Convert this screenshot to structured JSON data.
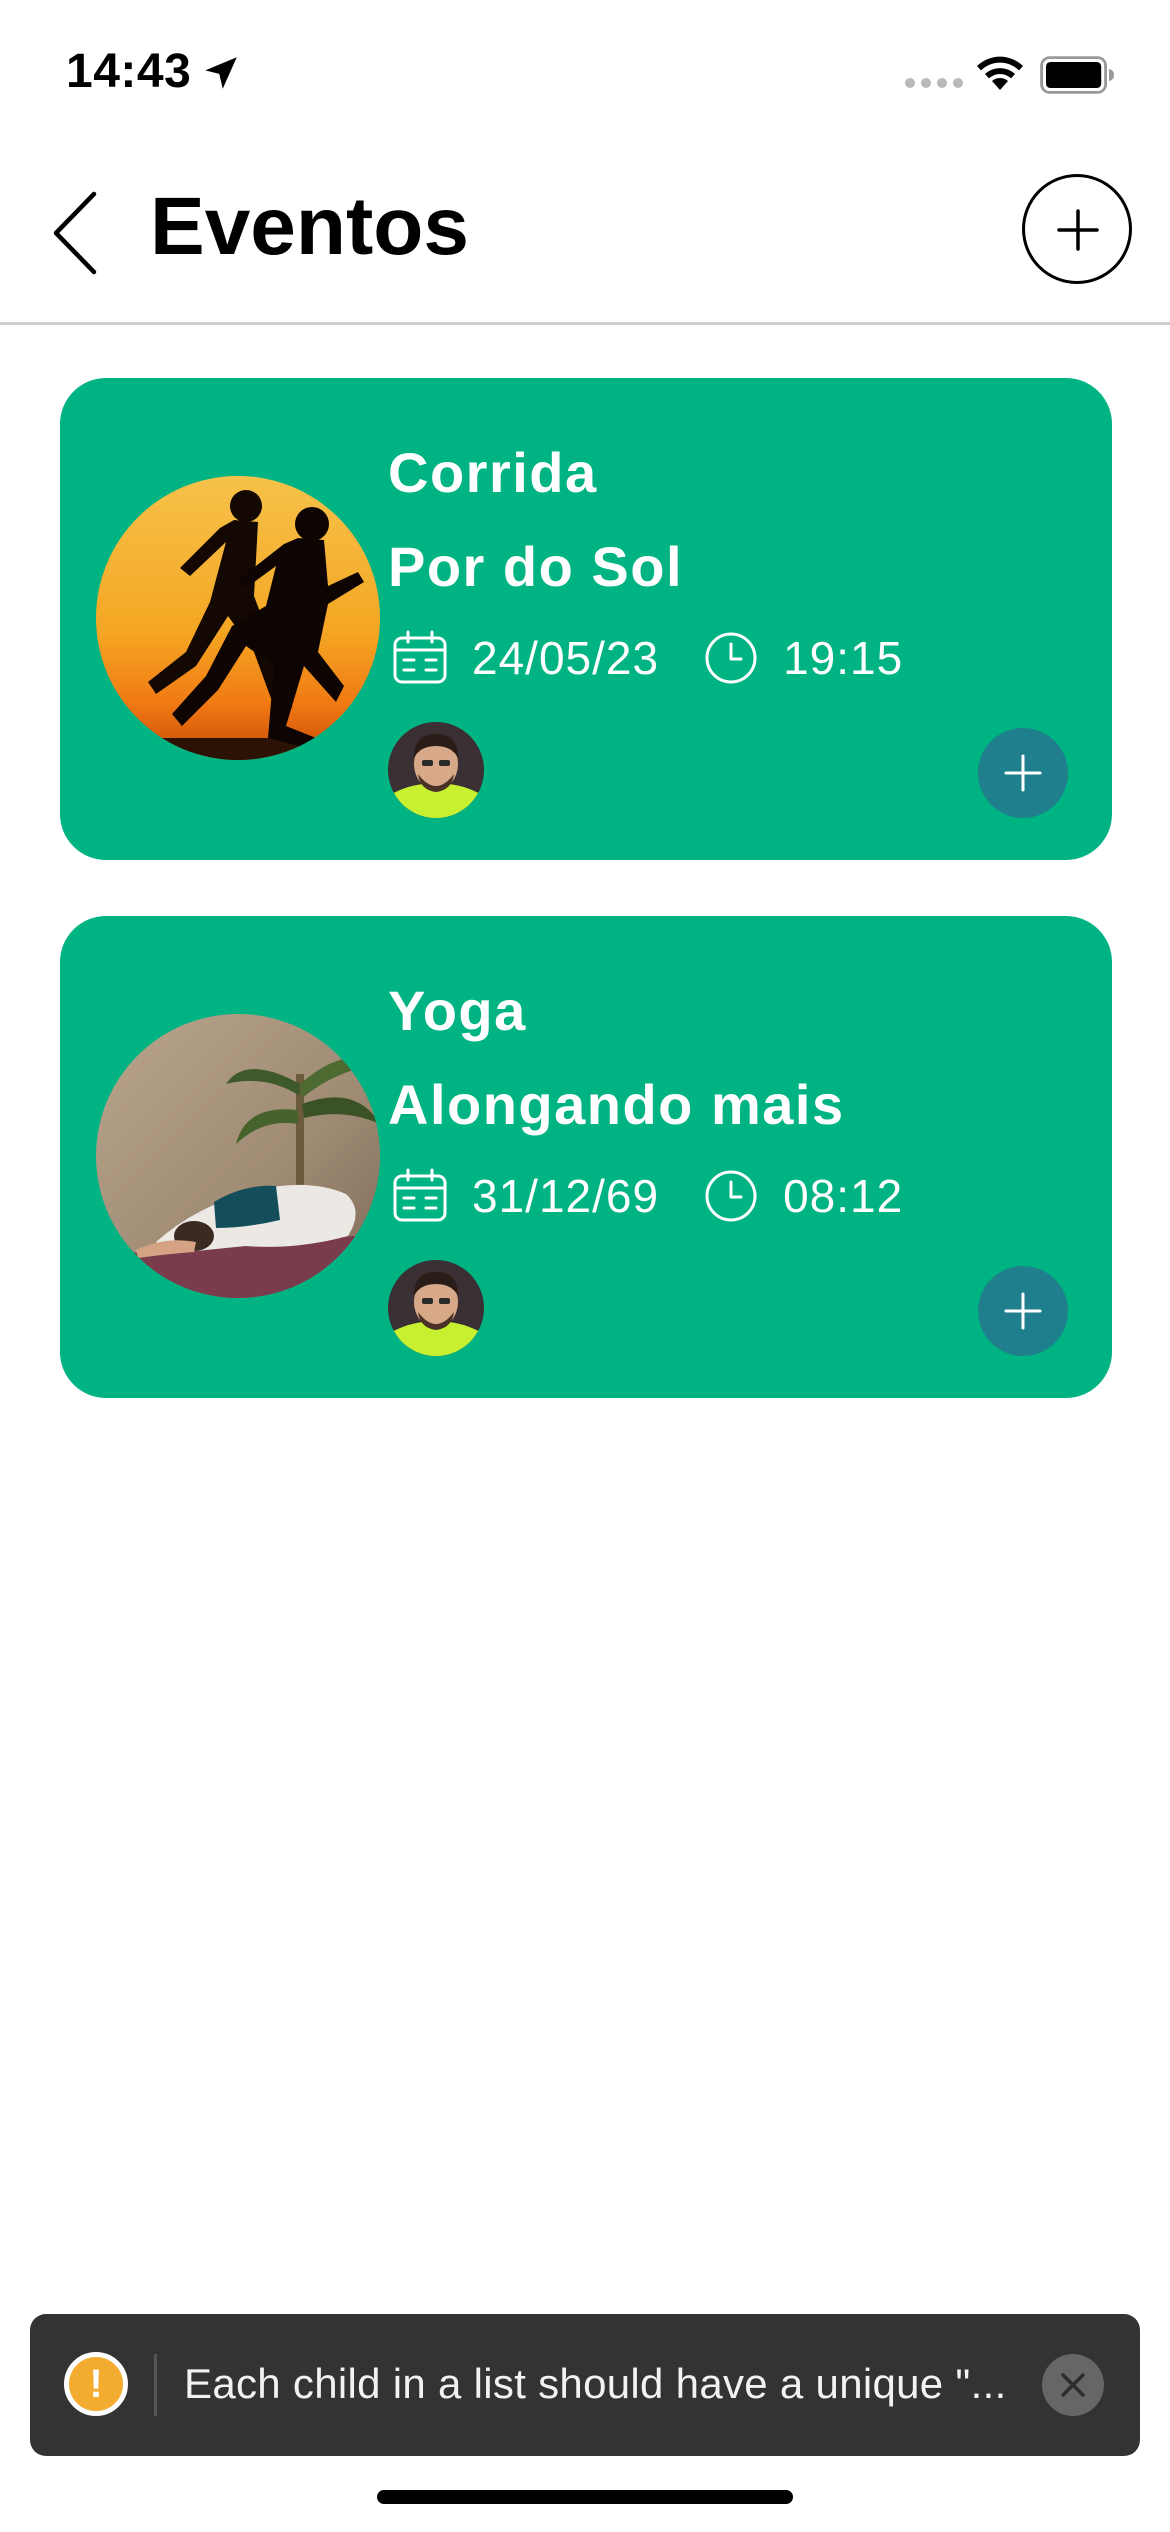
{
  "status_bar": {
    "time": "14:43",
    "icons": [
      "location-arrow-icon",
      "cellular-signal-icon",
      "wifi-icon",
      "battery-icon"
    ]
  },
  "header": {
    "title": "Eventos",
    "back_icon": "chevron-left-icon",
    "add_icon": "plus-icon"
  },
  "events": [
    {
      "title": "Corrida",
      "subtitle": "Por do Sol",
      "date": "24/05/23",
      "time": "19:15",
      "photo": "runners-sunset-photo",
      "participants": [
        "participant-avatar"
      ]
    },
    {
      "title": "Yoga",
      "subtitle": "Alongando mais",
      "date": "31/12/69",
      "time": "08:12",
      "photo": "yoga-pose-photo",
      "participants": [
        "participant-avatar"
      ]
    }
  ],
  "toast": {
    "message": "Each child in a list should have a unique \"...",
    "icon": "warning-icon",
    "close_icon": "close-icon"
  },
  "colors": {
    "card_bg": "#00b383",
    "join_button_bg": "#1f7f8c",
    "toast_bg": "#333333",
    "warning": "#f3ac2f"
  }
}
